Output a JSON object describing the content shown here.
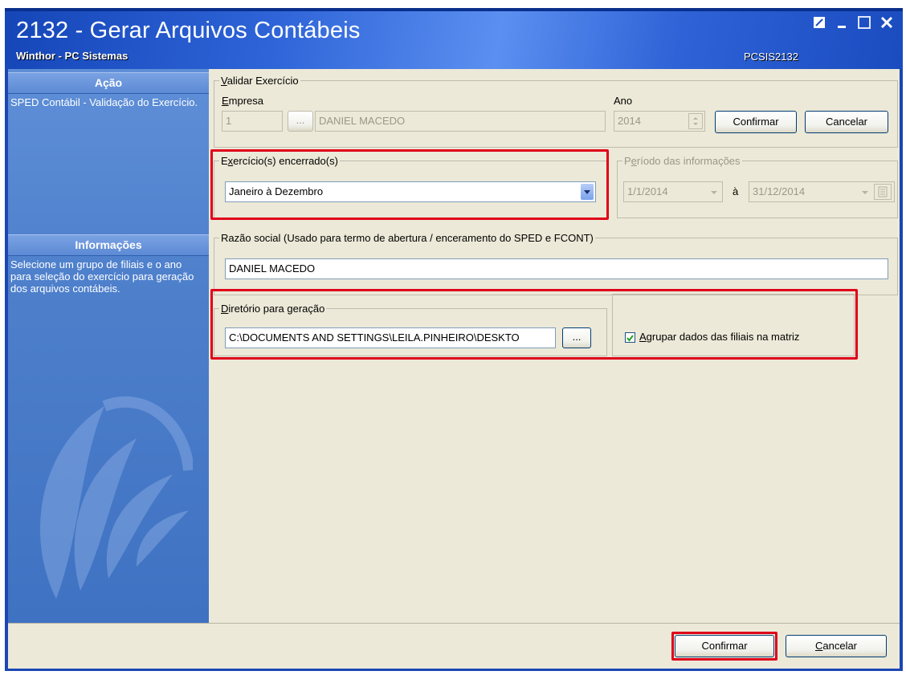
{
  "window": {
    "title": "2132 - Gerar Arquivos Contábeis",
    "subtitle": "Winthor - PC Sistemas",
    "code": "PCSIS2132",
    "controls": [
      "restore-icon",
      "minimize-icon",
      "maximize-icon",
      "close-icon"
    ]
  },
  "sidebar": {
    "acao_header": "Ação",
    "acao_text": "SPED Contábil - Validação do Exercício.",
    "info_header": "Informações",
    "info_text": "Selecione um grupo de filiais e o ano para seleção do exercício para geração dos arquivos contábeis."
  },
  "validar": {
    "legend": "Validar Exercício",
    "empresa_label": "Empresa",
    "empresa_code": "1",
    "browse_label": "...",
    "empresa_name": "DANIEL MACEDO",
    "ano_label": "Ano",
    "ano_value": "2014",
    "confirm_label": "Confirmar",
    "cancel_label": "Cancelar"
  },
  "exercicio": {
    "legend": "Exercício(s) encerrado(s)",
    "selected": "Janeiro à Dezembro"
  },
  "periodo": {
    "legend": "Período das informações",
    "from": "1/1/2014",
    "sep": "à",
    "to": "31/12/2014"
  },
  "razao": {
    "legend": "Razão social (Usado para termo de abertura / enceramento do SPED e FCONT)",
    "value": "DANIEL MACEDO"
  },
  "diretorio": {
    "legend": "Diretório para geração",
    "path": "C:\\DOCUMENTS AND SETTINGS\\LEILA.PINHEIRO\\DESKTO",
    "browse_label": "...",
    "agrupar_label": "Agrupar dados das filiais na matriz",
    "agrupar_checked": true
  },
  "footer": {
    "confirm_label": "Confirmar",
    "cancel_label": "Cancelar"
  },
  "colors": {
    "titlebar": "#2e64d8",
    "highlight": "#e0001a",
    "panel": "#ece9d8"
  }
}
